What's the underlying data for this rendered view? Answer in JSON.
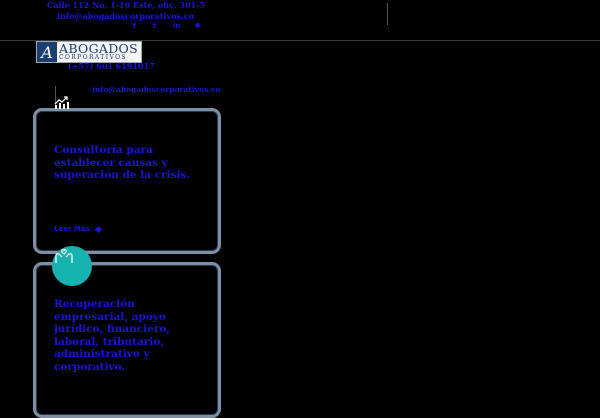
{
  "topbar": {
    "address": "Calle 112 No. 1-10 Este, ofic. 301-5",
    "email": "info@abogadoscorporativos.co",
    "social": [
      {
        "label": "f",
        "icon": "facebook-icon"
      },
      {
        "label": "t",
        "icon": "twitter-icon"
      },
      {
        "label": "in",
        "icon": "linkedin-icon"
      },
      {
        "label": "●",
        "icon": "youtube-icon"
      }
    ]
  },
  "logo": {
    "monogram": "A",
    "title": "ABOGADOS",
    "subtitle": "CORPORATIVOS"
  },
  "contact": {
    "phone": "(+57) 601 6191017",
    "email": "info@abogadoscorporativos.co"
  },
  "cards": [
    {
      "text": "Consultoría para establecer causas y superación de la crisis.",
      "link": "Leer Más",
      "icon": "chart-icon"
    },
    {
      "text": "Recuperación empresarial, apoyo jurídico, financiero, laboral, tributario, administrativo y corporativo.",
      "icon": "hands-icon"
    }
  ],
  "colors": {
    "background": "#000000",
    "text": "#1a14d8",
    "card_border": "#7d8fa4",
    "accent": "#17b3b0"
  }
}
